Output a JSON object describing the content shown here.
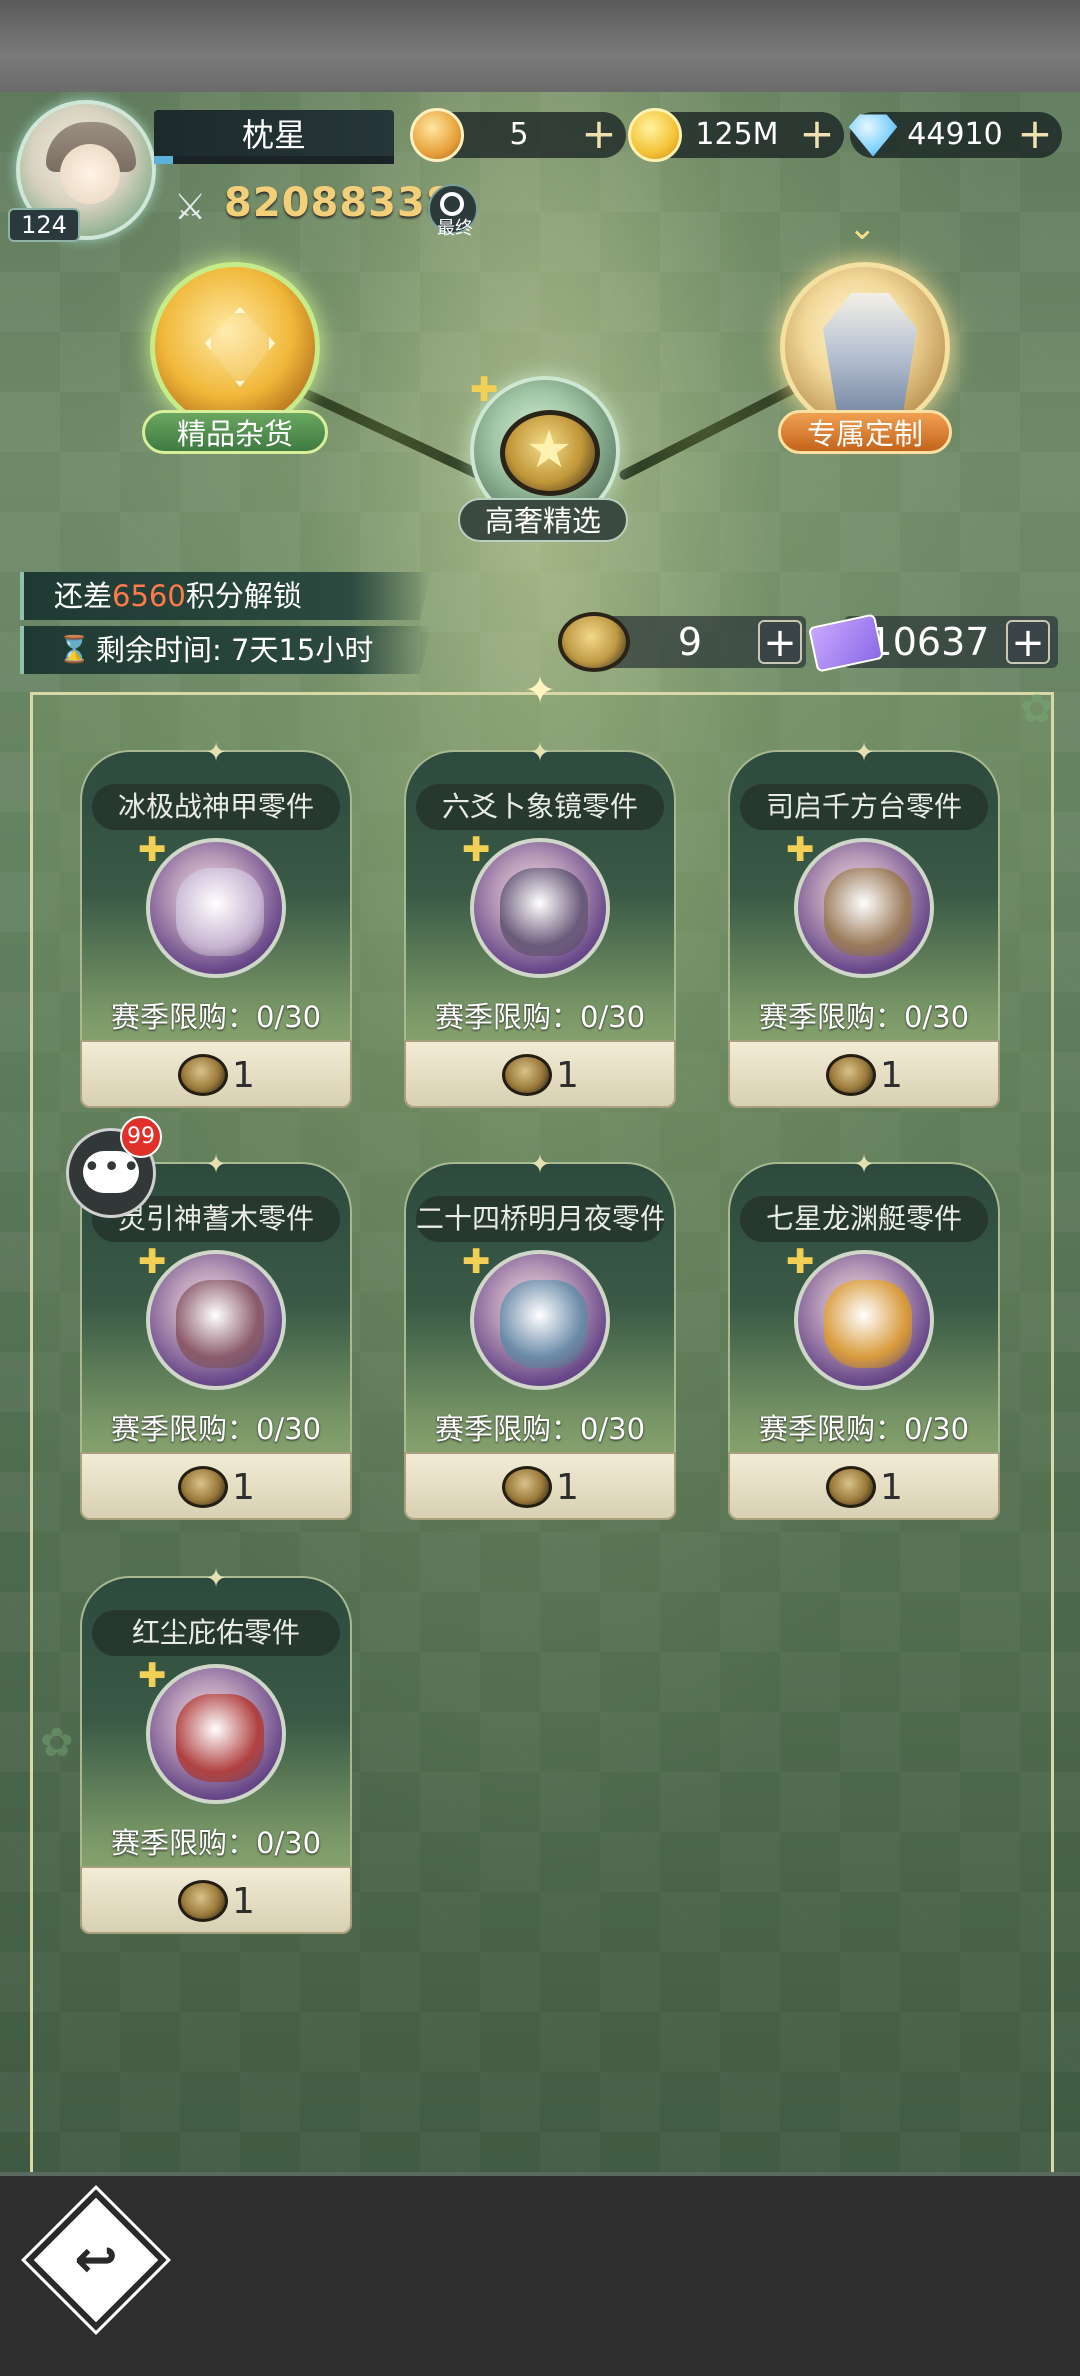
{
  "player": {
    "name": "枕星",
    "level": "124",
    "power": "82088338",
    "rank_label": "最终"
  },
  "currencies": [
    {
      "icon": "gold-medal-icon",
      "value": "5",
      "plus": "+"
    },
    {
      "icon": "gold-coin-icon",
      "value": "125M",
      "plus": "+"
    },
    {
      "icon": "diamond-icon",
      "value": "44910",
      "plus": "+"
    }
  ],
  "shops": {
    "left": "精品杂货",
    "center": "高奢精选",
    "right": "专属定制"
  },
  "unlock": {
    "prefix": "还差",
    "points": "6560",
    "suffix": "积分解锁",
    "remaining": "剩余时间: 7天15小时"
  },
  "sub_currencies": [
    {
      "icon": "token-coin-icon",
      "value": "9",
      "plus": "+"
    },
    {
      "icon": "ticket-icon",
      "value": "10637",
      "plus": "+"
    }
  ],
  "items": [
    {
      "name": "冰极战神甲零件",
      "limit": "赛季限购：0/30",
      "price": "1",
      "color": "#c8b6d2"
    },
    {
      "name": "六爻卜象镜零件",
      "limit": "赛季限购：0/30",
      "price": "1",
      "color": "#6a5a7a"
    },
    {
      "name": "司启千方台零件",
      "limit": "赛季限购：0/30",
      "price": "1",
      "color": "#9a7a5a"
    },
    {
      "name": "灵引神蓍木零件",
      "limit": "赛季限购：0/30",
      "price": "1",
      "color": "#8a5a6a"
    },
    {
      "name": "二十四桥明月夜零件",
      "limit": "赛季限购：0/30",
      "price": "1",
      "color": "#6a8aa8"
    },
    {
      "name": "七星龙渊艇零件",
      "limit": "赛季限购：0/30",
      "price": "1",
      "color": "#d89a3a"
    },
    {
      "name": "红尘庇佑零件",
      "limit": "赛季限购：0/30",
      "price": "1",
      "color": "#b04040"
    }
  ],
  "chat": {
    "badge": "99"
  },
  "colors": {
    "accent_orange": "#ff7a4a",
    "power_gold": "#f4cf7a",
    "badge_red": "#e0302a"
  }
}
